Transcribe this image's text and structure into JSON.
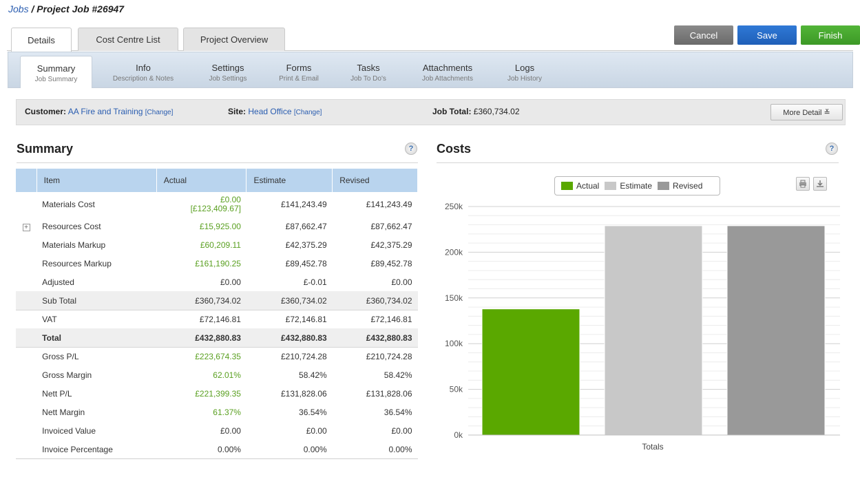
{
  "breadcrumb": {
    "root": "Jobs",
    "separator": " / ",
    "current": "Project Job #26947"
  },
  "tabs": [
    {
      "label": "Details",
      "active": true
    },
    {
      "label": "Cost Centre List",
      "active": false
    },
    {
      "label": "Project Overview",
      "active": false
    }
  ],
  "actions": {
    "cancel": "Cancel",
    "save": "Save",
    "finish": "Finish"
  },
  "subtabs": [
    {
      "label": "Summary",
      "sub": "Job Summary",
      "active": true
    },
    {
      "label": "Info",
      "sub": "Description & Notes"
    },
    {
      "label": "Settings",
      "sub": "Job Settings"
    },
    {
      "label": "Forms",
      "sub": "Print & Email"
    },
    {
      "label": "Tasks",
      "sub": "Job To Do's"
    },
    {
      "label": "Attachments",
      "sub": "Job Attachments"
    },
    {
      "label": "Logs",
      "sub": "Job History"
    }
  ],
  "info_bar": {
    "customer_label": "Customer:",
    "customer_value": "AA Fire and Training",
    "customer_change": "[Change]",
    "site_label": "Site:",
    "site_value": "Head Office",
    "site_change": "[Change]",
    "job_total_label": "Job Total:",
    "job_total_value": "£360,734.02",
    "more_detail": "More Detail ≚"
  },
  "summary": {
    "title": "Summary",
    "help": "?",
    "headers": [
      "Item",
      "Actual",
      "Estimate",
      "Revised"
    ],
    "rows": [
      {
        "item": "Materials Cost",
        "actual": "£0.00",
        "actual_sub": "[£123,409.67]",
        "estimate": "£141,243.49",
        "revised": "£141,243.49",
        "green": true
      },
      {
        "item": "Resources Cost",
        "actual": "£15,925.00",
        "estimate": "£87,662.47",
        "revised": "£87,662.47",
        "green": true,
        "expand": "+"
      },
      {
        "item": "Materials Markup",
        "actual": "£60,209.11",
        "estimate": "£42,375.29",
        "revised": "£42,375.29",
        "green": true
      },
      {
        "item": "Resources Markup",
        "actual": "£161,190.25",
        "estimate": "£89,452.78",
        "revised": "£89,452.78",
        "green": true
      },
      {
        "item": "Adjusted",
        "actual": "£0.00",
        "estimate": "£-0.01",
        "revised": "£0.00"
      },
      {
        "item": "Sub Total",
        "actual": "£360,734.02",
        "estimate": "£360,734.02",
        "revised": "£360,734.02",
        "shade": true
      },
      {
        "item": "VAT",
        "actual": "£72,146.81",
        "estimate": "£72,146.81",
        "revised": "£72,146.81"
      },
      {
        "item": "Total",
        "actual": "£432,880.83",
        "estimate": "£432,880.83",
        "revised": "£432,880.83",
        "shade": true,
        "bold": true
      },
      {
        "item": "Gross P/L",
        "actual": "£223,674.35",
        "estimate": "£210,724.28",
        "revised": "£210,724.28",
        "green": true
      },
      {
        "item": "Gross Margin",
        "actual": "62.01%",
        "estimate": "58.42%",
        "revised": "58.42%",
        "green": true
      },
      {
        "item": "Nett P/L",
        "actual": "£221,399.35",
        "estimate": "£131,828.06",
        "revised": "£131,828.06",
        "green": true
      },
      {
        "item": "Nett Margin",
        "actual": "61.37%",
        "estimate": "36.54%",
        "revised": "36.54%",
        "green": true
      },
      {
        "item": "Invoiced Value",
        "actual": "£0.00",
        "estimate": "£0.00",
        "revised": "£0.00"
      },
      {
        "item": "Invoice Percentage",
        "actual": "0.00%",
        "estimate": "0.00%",
        "revised": "0.00%"
      }
    ]
  },
  "costs": {
    "title": "Costs",
    "help": "?",
    "print_icon": "print-icon",
    "download_icon": "download-icon"
  },
  "chart_data": {
    "type": "bar",
    "categories": [
      "Totals"
    ],
    "series": [
      {
        "name": "Actual",
        "values": [
          138000
        ],
        "color": "#5aa800"
      },
      {
        "name": "Estimate",
        "values": [
          229000
        ],
        "color": "#c8c8c8"
      },
      {
        "name": "Revised",
        "values": [
          229000
        ],
        "color": "#999999"
      }
    ],
    "yticks": [
      "0k",
      "50k",
      "100k",
      "150k",
      "200k",
      "250k"
    ],
    "ylim": [
      0,
      250000
    ],
    "legend": "top-center",
    "grid": true
  }
}
